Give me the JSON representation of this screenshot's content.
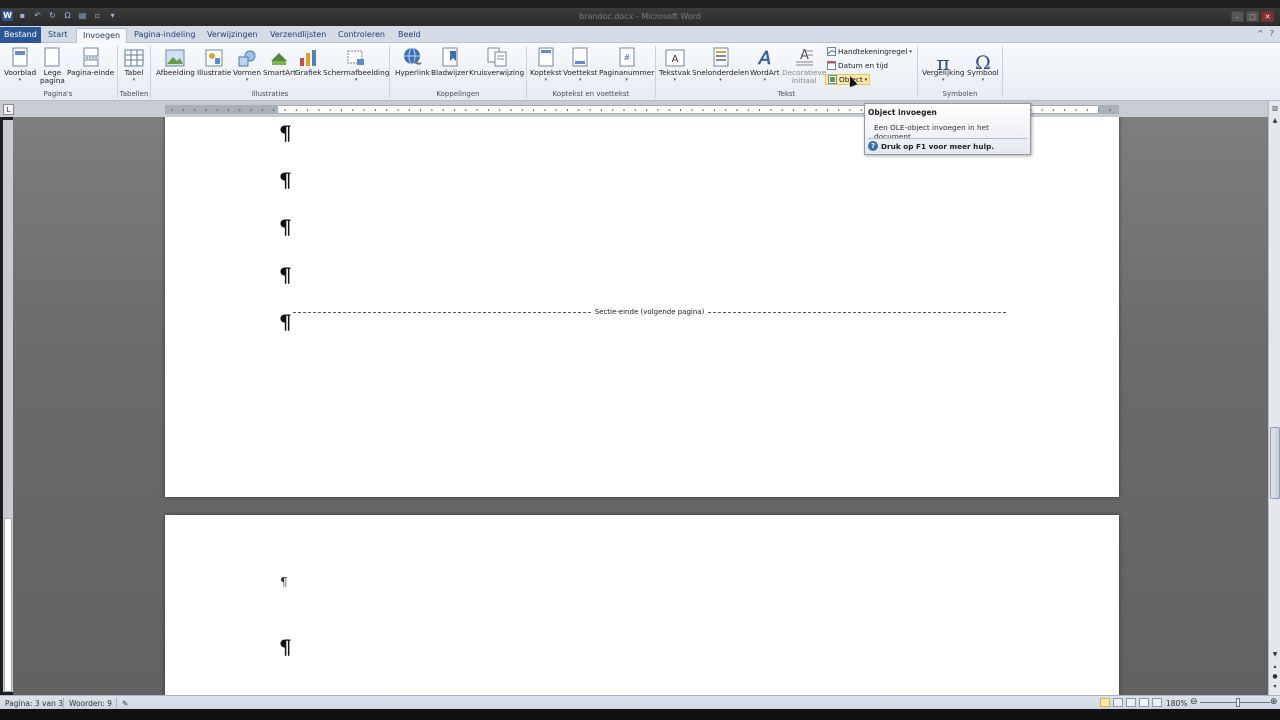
{
  "window": {
    "title": "brandoc.docx - Microsoft Word",
    "word_logo": "W",
    "controls": [
      "–",
      "□",
      "✕"
    ]
  },
  "tabs": {
    "file": "Bestand",
    "items": [
      "Start",
      "Invoegen",
      "Pagina-indeling",
      "Verwijzingen",
      "Verzendlijsten",
      "Controleren",
      "Beeld"
    ],
    "active": "Invoegen"
  },
  "ribbon": {
    "groups": {
      "pages": "Pagina's",
      "tables": "Tabellen",
      "illustrations": "Illustraties",
      "links": "Koppelingen",
      "header_footer": "Koptekst en voettekst",
      "text": "Tekst",
      "symbols": "Symbolen"
    },
    "buttons": {
      "cover_page": "Voorblad",
      "blank_page_1": "Lege",
      "blank_page_2": "pagina",
      "page_break": "Pagina-einde",
      "table": "Tabel",
      "picture": "Afbeelding",
      "clip_art": "Illustratie",
      "shapes": "Vormen",
      "smartart": "SmartArt",
      "chart": "Grafiek",
      "screenshot": "Schermafbeelding",
      "hyperlink": "Hyperlink",
      "bookmark": "Bladwijzer",
      "cross_reference": "Kruisverwijzing",
      "header": "Koptekst",
      "footer": "Voettekst",
      "page_number": "Paginanummer",
      "text_box": "Tekstvak",
      "quick_parts": "Snelonderdelen",
      "wordart": "WordArt",
      "drop_cap_1": "Decoratieve",
      "drop_cap_2": "initiaal",
      "signature_line": "Handtekeningregel",
      "date_time": "Datum en tijd",
      "object": "Object",
      "equation": "Vergelijking",
      "symbol": "Symbool"
    }
  },
  "tooltip": {
    "title": "Object invoegen",
    "description": "Een OLE-object invoegen in het document.",
    "help": "Druk op F1 voor meer hulp."
  },
  "document": {
    "pilcrow": "¶",
    "section_break": "Sectie-einde (volgende pagina)"
  },
  "statusbar": {
    "page": "Pagina: 3 van 3",
    "words": "Woorden: 9",
    "zoom": "180%"
  }
}
